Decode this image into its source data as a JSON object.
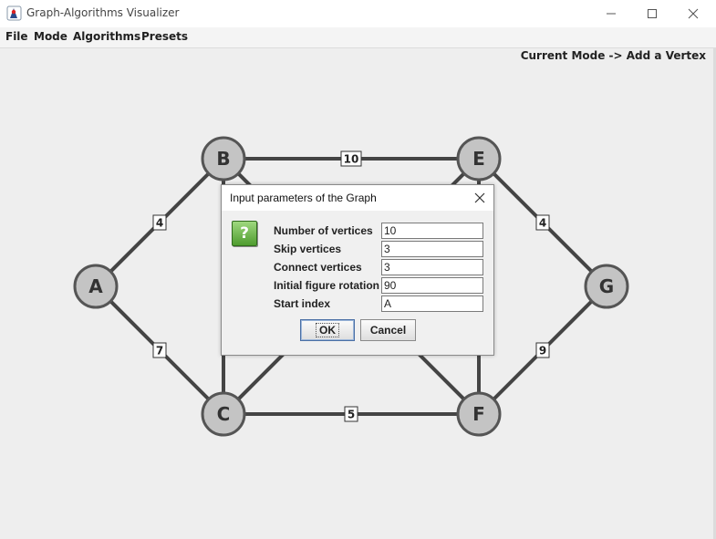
{
  "window": {
    "title": "Graph-Algorithms Visualizer",
    "app_icon": "duke-java-icon",
    "controls": [
      "minimize-icon",
      "maximize-icon",
      "close-icon"
    ]
  },
  "menu": {
    "items": [
      "File",
      "Mode",
      "Algorithms",
      "Presets"
    ]
  },
  "status": {
    "mode_text": "Current Mode -> Add a Vertex"
  },
  "graph": {
    "vertices": [
      {
        "id": "A",
        "label": "A"
      },
      {
        "id": "B",
        "label": "B"
      },
      {
        "id": "C",
        "label": "C"
      },
      {
        "id": "E",
        "label": "E"
      },
      {
        "id": "F",
        "label": "F"
      },
      {
        "id": "G",
        "label": "G"
      }
    ],
    "edges": [
      {
        "from": "B",
        "to": "E",
        "weight": "10"
      },
      {
        "from": "A",
        "to": "B",
        "weight": "4"
      },
      {
        "from": "E",
        "to": "G",
        "weight": "4"
      },
      {
        "from": "A",
        "to": "C",
        "weight": "7"
      },
      {
        "from": "F",
        "to": "G",
        "weight": "9"
      },
      {
        "from": "C",
        "to": "F",
        "weight": "5"
      },
      {
        "from": "B",
        "to": "C",
        "weight": ""
      },
      {
        "from": "E",
        "to": "F",
        "weight": ""
      },
      {
        "from": "B",
        "to": "F",
        "weight": ""
      },
      {
        "from": "C",
        "to": "E",
        "weight": ""
      }
    ]
  },
  "dialog": {
    "title": "Input parameters of the Graph",
    "close_icon": "close-icon",
    "icon": "question-icon",
    "icon_glyph": "?",
    "fields": [
      {
        "label": "Number of vertices",
        "value": "10"
      },
      {
        "label": "Skip vertices",
        "value": "3"
      },
      {
        "label": "Connect vertices",
        "value": "3"
      },
      {
        "label": "Initial figure rotation",
        "value": "90"
      },
      {
        "label": "Start index",
        "value": "A"
      }
    ],
    "ok_label": "OK",
    "cancel_label": "Cancel"
  },
  "colors": {
    "background": "#eeeeee",
    "edge": "#444444",
    "vertex_fill": "#c4c4c4",
    "vertex_stroke": "#555555"
  }
}
